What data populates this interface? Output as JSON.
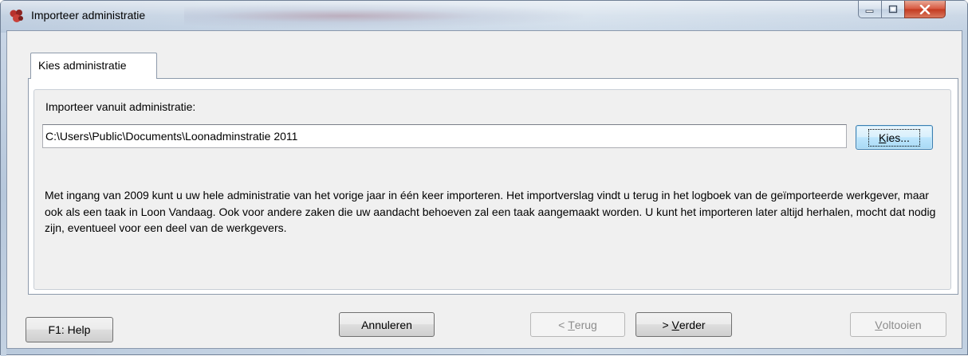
{
  "window": {
    "title": "Importeer administratie",
    "accent_color": "#c33a20"
  },
  "tabs": [
    {
      "label": "Kies administratie",
      "selected": true
    }
  ],
  "form": {
    "import_label": "Importeer vanuit administratie:",
    "path_value": "C:\\Users\\Public\\Documents\\Loonadminstratie 2011",
    "choose_button": {
      "underlined": "K",
      "rest": "ies..."
    }
  },
  "info_text": "Met ingang van 2009 kunt u uw hele administratie van het vorige jaar in één keer importeren. Het importverslag vindt u terug in het logboek van de geïmporteerde werkgever, maar ook als een taak in Loon Vandaag. Ook voor andere zaken die uw aandacht behoeven zal een taak aangemaakt worden. U kunt het importeren later altijd herhalen, mocht dat nodig zijn, eventueel voor een deel van de werkgevers.",
  "buttons": {
    "help": "F1: Help",
    "cancel": "Annuleren",
    "back": {
      "prefix": "< ",
      "underlined": "T",
      "rest": "erug",
      "enabled": false
    },
    "next": {
      "prefix": "> ",
      "underlined": "V",
      "rest": "erder",
      "enabled": true
    },
    "finish": {
      "prefix": "",
      "underlined": "V",
      "rest": "oltooien",
      "enabled": false
    }
  }
}
